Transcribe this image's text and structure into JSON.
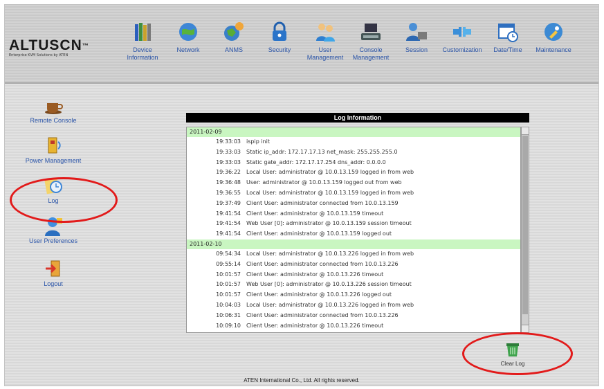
{
  "logo": {
    "main": "ALTUSCN",
    "tm": "™",
    "sub": "Enterprise KVM Solutions by ATEN"
  },
  "topnav": [
    {
      "label": "Device Information",
      "icon": "books-icon"
    },
    {
      "label": "Network",
      "icon": "network-icon"
    },
    {
      "label": "ANMS",
      "icon": "anms-icon"
    },
    {
      "label": "Security",
      "icon": "lock-icon"
    },
    {
      "label": "User Management",
      "icon": "users-icon"
    },
    {
      "label": "Console Management",
      "icon": "keyboard-icon"
    },
    {
      "label": "Session",
      "icon": "session-icon"
    },
    {
      "label": "Customization",
      "icon": "customization-icon"
    },
    {
      "label": "Date/Time",
      "icon": "calendar-clock-icon"
    },
    {
      "label": "Maintenance",
      "icon": "maintenance-icon"
    }
  ],
  "sidebar": [
    {
      "label": "Remote Console",
      "icon": "coffee-cup-icon"
    },
    {
      "label": "Power Management",
      "icon": "power-icon"
    },
    {
      "label": "Log",
      "icon": "log-icon"
    },
    {
      "label": "User Preferences",
      "icon": "user-preferences-icon"
    },
    {
      "label": "Logout",
      "icon": "logout-icon"
    }
  ],
  "panel": {
    "title": "Log Information"
  },
  "log": {
    "groups": [
      {
        "date": "2011-02-09",
        "entries": [
          {
            "time": "19:33:03",
            "message": "ispip init"
          },
          {
            "time": "19:33:03",
            "message": "Static ip_addr: 172.17.17.13 net_mask: 255.255.255.0"
          },
          {
            "time": "19:33:03",
            "message": "Static gate_addr: 172.17.17.254 dns_addr: 0.0.0.0"
          },
          {
            "time": "19:36:22",
            "message": "Local User: administrator @ 10.0.13.159 logged in from web"
          },
          {
            "time": "19:36:48",
            "message": "User: administrator @ 10.0.13.159 logged out from web"
          },
          {
            "time": "19:36:55",
            "message": "Local User: administrator @ 10.0.13.159 logged in from web"
          },
          {
            "time": "19:37:49",
            "message": "Client User: administrator connected from 10.0.13.159"
          },
          {
            "time": "19:41:54",
            "message": "Client User: administrator @ 10.0.13.159 timeout"
          },
          {
            "time": "19:41:54",
            "message": "Web User [0]: administrator @ 10.0.13.159 session timeout"
          },
          {
            "time": "19:41:54",
            "message": "Client User: administrator @ 10.0.13.159 logged out"
          }
        ]
      },
      {
        "date": "2011-02-10",
        "entries": [
          {
            "time": "09:54:34",
            "message": "Local User: administrator @ 10.0.13.226 logged in from web"
          },
          {
            "time": "09:55:14",
            "message": "Client User: administrator connected from 10.0.13.226"
          },
          {
            "time": "10:01:57",
            "message": "Client User: administrator @ 10.0.13.226 timeout"
          },
          {
            "time": "10:01:57",
            "message": "Web User [0]: administrator @ 10.0.13.226 session timeout"
          },
          {
            "time": "10:01:57",
            "message": "Client User: administrator @ 10.0.13.226 logged out"
          },
          {
            "time": "10:04:03",
            "message": "Local User: administrator @ 10.0.13.226 logged in from web"
          },
          {
            "time": "10:06:31",
            "message": "Client User: administrator connected from 10.0.13.226"
          },
          {
            "time": "10:09:10",
            "message": "Client User: administrator @ 10.0.13.226 timeout"
          }
        ]
      }
    ]
  },
  "actions": {
    "clear_log_label": "Clear Log",
    "clear_log_icon": "clear-log-icon"
  },
  "footer": {
    "text": "ATEN International Co., Ltd. All rights reserved."
  },
  "colors": {
    "nav_text": "#2a54a8",
    "date_row": "#c9f6c1",
    "highlight": "#e21a1a"
  }
}
